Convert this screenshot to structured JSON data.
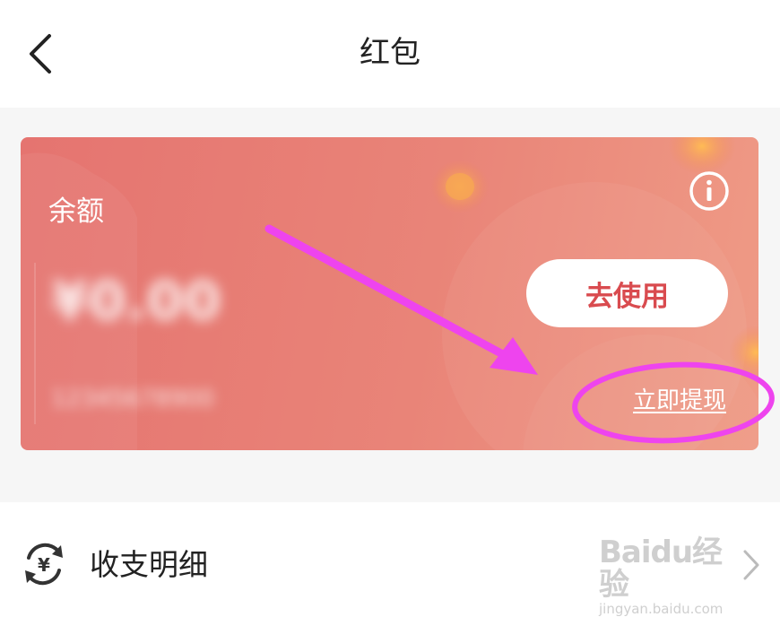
{
  "header": {
    "title": "红包",
    "back_icon": "chevron-left-icon"
  },
  "card": {
    "balance_label": "余额",
    "amount": "¥0.00",
    "sub_text": "12345678900",
    "info_icon": "info-icon",
    "use_button_label": "去使用",
    "withdraw_label": "立即提现",
    "colors": {
      "gradient_start": "#e57470",
      "gradient_end": "#ef9b86",
      "button_text": "#d94b4f"
    }
  },
  "annotation": {
    "color": "#ee44ee",
    "shapes": [
      "arrow",
      "ellipse"
    ]
  },
  "detail": {
    "label": "收支明细",
    "icon": "yuan-exchange-icon",
    "chevron_icon": "chevron-right-icon"
  },
  "watermark": {
    "main": "Baidu经验",
    "sub": "jingyan.baidu.com"
  }
}
